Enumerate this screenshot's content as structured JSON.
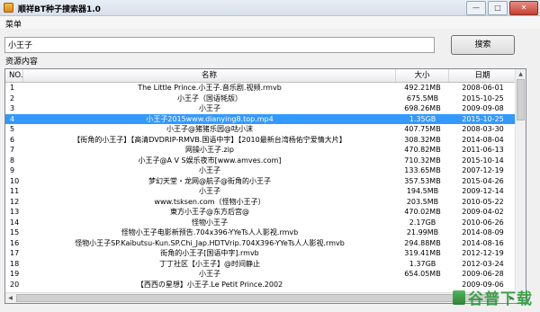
{
  "window": {
    "title": "顺祥BT种子搜索器1.0",
    "min": "—",
    "max": "□",
    "close": "✕"
  },
  "menu": {
    "label": "菜单"
  },
  "search": {
    "value": "小王子",
    "button": "搜索"
  },
  "group_label": "资源内容",
  "columns": {
    "no": "NO.",
    "name": "名称",
    "size": "大小",
    "date": "日期"
  },
  "rows": [
    {
      "no": "1",
      "name": "The Little Prince.小王子.音乐剧.视频.rmvb",
      "size": "492.21MB",
      "date": "2008-06-01"
    },
    {
      "no": "2",
      "name": "小王子（国语牦版）",
      "size": "675.5MB",
      "date": "2015-10-25"
    },
    {
      "no": "3",
      "name": "小王子",
      "size": "698.26MB",
      "date": "2009-09-08"
    },
    {
      "no": "4",
      "name": "小王子2015www.dianying8.top.mp4",
      "size": "1.35GB",
      "date": "2015-10-25"
    },
    {
      "no": "5",
      "name": "小王子@猪猪乐园@咕小沫",
      "size": "407.75MB",
      "date": "2008-03-30"
    },
    {
      "no": "6",
      "name": "【街角的小王子】【高清DVDRIP-RMVB.国语中字】【2010最新台湾杨佑宁爱情大片】",
      "size": "308.32MB",
      "date": "2014-08-04"
    },
    {
      "no": "7",
      "name": "网操小王子.zip",
      "size": "470.82MB",
      "date": "2011-06-13"
    },
    {
      "no": "8",
      "name": "小王子@A V S娱乐夜市[www.amves.com]",
      "size": "710.32MB",
      "date": "2015-10-14"
    },
    {
      "no": "9",
      "name": "小王子",
      "size": "133.65MB",
      "date": "2007-12-19"
    },
    {
      "no": "10",
      "name": "梦幻天堂・龙网@航子@街角的小王子",
      "size": "357.53MB",
      "date": "2015-04-26"
    },
    {
      "no": "11",
      "name": "小王子",
      "size": "194.5MB",
      "date": "2009-12-14"
    },
    {
      "no": "12",
      "name": "www.tsksen.com（怪物小王子）",
      "size": "203.5MB",
      "date": "2010-05-22"
    },
    {
      "no": "13",
      "name": "東方小王子@东方后宫@",
      "size": "470.02MB",
      "date": "2009-04-02"
    },
    {
      "no": "14",
      "name": "怪物小王子",
      "size": "2.17GB",
      "date": "2010-06-26"
    },
    {
      "no": "15",
      "name": "怪物小王子电影新预告.704x396-YYeTs人人影视.rmvb",
      "size": "21.99MB",
      "date": "2014-08-09"
    },
    {
      "no": "16",
      "name": "怪物小王子SP.Kaibutsu-Kun.SP.Chi_Jap.HDTVrip.704X396-YYeTs人人影视.rmvb",
      "size": "294.88MB",
      "date": "2014-08-16"
    },
    {
      "no": "17",
      "name": "街角的小王子[国语中字].rmvb",
      "size": "319.41MB",
      "date": "2012-12-19"
    },
    {
      "no": "18",
      "name": "丁丁社区【小王子】@时间静止",
      "size": "1.37GB",
      "date": "2012-03-24"
    },
    {
      "no": "19",
      "name": "小王子",
      "size": "654.05MB",
      "date": "2009-06-28"
    },
    {
      "no": "20",
      "name": "【西西の星想】小王子.Le Petit Prince.2002",
      "size": "",
      "date": "2009-09-06"
    }
  ],
  "selected_row": "4",
  "watermark": "谷普下载",
  "colors": {
    "selection": "#3399ff",
    "watermark": "#2a9a3a"
  }
}
